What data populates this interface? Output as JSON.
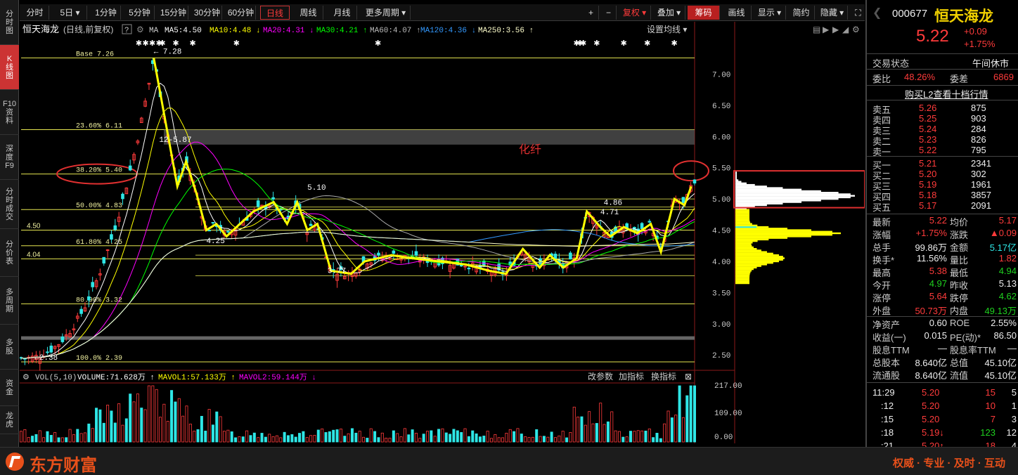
{
  "sidebar": [
    {
      "label": "分\n时\n图",
      "active": false
    },
    {
      "label": "K\n线\n图",
      "active": true
    },
    {
      "label": "F10\n资\n料",
      "active": false
    },
    {
      "label": "深\n度\nF9",
      "active": false
    },
    {
      "label": "分\n时\n成\n交",
      "active": false
    },
    {
      "label": "分\n价\n表",
      "active": false
    },
    {
      "label": "多\n周\n期",
      "active": false
    },
    {
      "label": "多\n股",
      "active": false
    },
    {
      "label": "资\n金",
      "active": false
    },
    {
      "label": "龙\n虎",
      "active": false
    }
  ],
  "toolbar": {
    "periods": [
      "分时",
      "5日 ▾",
      "1分钟",
      "5分钟",
      "15分钟",
      "30分钟",
      "60分钟",
      "日线",
      "周线",
      "月线",
      "更多周期 ▾"
    ],
    "active_period": "日线",
    "right_buttons": [
      "+",
      "−",
      "复权 ▾",
      "叠加 ▾",
      "筹码",
      "画线",
      "显示 ▾",
      "简约",
      "隐藏 ▾",
      "⛶"
    ],
    "active_right": "筹码"
  },
  "chart": {
    "header": {
      "name": "恒天海龙",
      "mode": "(日线,前复权)",
      "help": "?",
      "ma_items": [
        {
          "text": "MA",
          "color": "#cccccc"
        },
        {
          "text": "MA5:4.50",
          "color": "#ffffff"
        },
        {
          "text": "MA10:4.48 ↓",
          "color": "#ffff00"
        },
        {
          "text": "MA20:4.31 ↓",
          "color": "#ff00ff"
        },
        {
          "text": "MA30:4.21 ↑",
          "color": "#00ff00"
        },
        {
          "text": "MA60:4.07 ↑",
          "color": "#bbbbbb"
        },
        {
          "text": "MA120:4.36 ↓",
          "color": "#3399ff"
        },
        {
          "text": "MA250:3.56 ↑",
          "color": "#ffffcc"
        }
      ],
      "settings": "设置均线 ▾"
    },
    "price_axis": [
      "7.00",
      "6.50",
      "6.00",
      "5.50",
      "5.00",
      "4.50",
      "4.00",
      "3.50",
      "3.00",
      "2.50"
    ],
    "fib_labels": [
      "Base 7.26",
      "23.60% 6.11",
      "38.20% 5.40",
      "50.00% 4.83",
      "61.80% 4.25",
      "80.90% 3.32",
      "100.0% 2.39"
    ],
    "annotations": [
      "7.28",
      "12-5.87",
      "5.10",
      "4.25",
      "3.77",
      "4.86",
      "4.71",
      "4.50",
      "4.04",
      "2.38",
      "化纤"
    ],
    "volume": {
      "header": [
        "VOL(5,10)",
        "VOLUME:71.628万 ↑",
        "MAVOL1:57.133万 ↑",
        "MAVOL2:59.144万 ↓"
      ],
      "buttons": [
        "改参数",
        "加指标",
        "换指标"
      ],
      "axis": [
        "217.00",
        "109.00",
        "0.00"
      ]
    },
    "chart_data": {
      "type": "candlestick",
      "ylim": [
        2.3,
        7.5
      ],
      "fib_levels": [
        7.26,
        6.11,
        5.4,
        4.83,
        4.25,
        3.32,
        2.39
      ],
      "price_labels": [
        {
          "text": "7.28",
          "x": 0.197,
          "price": 7.28
        },
        {
          "text": "5.87",
          "x": 0.205,
          "price": 5.87
        },
        {
          "text": "5.10",
          "x": 0.425,
          "price": 5.1
        },
        {
          "text": "4.25",
          "x": 0.275,
          "price": 4.25
        },
        {
          "text": "3.77",
          "x": 0.455,
          "price": 3.77
        },
        {
          "text": "4.86",
          "x": 0.865,
          "price": 4.86
        },
        {
          "text": "4.71",
          "x": 0.86,
          "price": 4.71
        },
        {
          "text": "2.38",
          "x": 0.02,
          "price": 2.38
        }
      ],
      "zigzag": [
        [
          0.197,
          7.26
        ],
        [
          0.232,
          5.2
        ],
        [
          0.245,
          5.6
        ],
        [
          0.26,
          5.1
        ],
        [
          0.275,
          4.5
        ],
        [
          0.29,
          4.6
        ],
        [
          0.305,
          4.4
        ],
        [
          0.345,
          4.8
        ],
        [
          0.375,
          4.95
        ],
        [
          0.395,
          4.6
        ],
        [
          0.41,
          4.95
        ],
        [
          0.425,
          4.5
        ],
        [
          0.44,
          4.6
        ],
        [
          0.46,
          3.85
        ],
        [
          0.49,
          3.8
        ],
        [
          0.51,
          4.0
        ],
        [
          0.55,
          4.1
        ],
        [
          0.58,
          4.05
        ],
        [
          0.62,
          4.0
        ],
        [
          0.66,
          3.95
        ],
        [
          0.695,
          3.85
        ],
        [
          0.72,
          3.8
        ],
        [
          0.745,
          4.2
        ],
        [
          0.77,
          3.9
        ],
        [
          0.785,
          4.1
        ],
        [
          0.805,
          3.9
        ],
        [
          0.825,
          4.05
        ],
        [
          0.84,
          4.8
        ],
        [
          0.86,
          4.55
        ],
        [
          0.875,
          4.4
        ],
        [
          0.895,
          4.55
        ],
        [
          0.915,
          4.45
        ],
        [
          0.935,
          4.6
        ],
        [
          0.95,
          4.15
        ],
        [
          0.97,
          5.0
        ],
        [
          0.985,
          4.9
        ],
        [
          0.995,
          5.2
        ]
      ]
    }
  },
  "right_panel": {
    "code": "000677",
    "name": "恒天海龙",
    "price": "5.22",
    "change": "+0.09",
    "change_pct": "+1.75%",
    "trade_status_label": "交易状态",
    "trade_status": "午间休市",
    "weibi_label": "委比",
    "weibi": "48.26%",
    "weicha_label": "委差",
    "weicha": "6869",
    "l2_link": "购买L2查看十档行情",
    "sells": [
      {
        "label": "卖五",
        "price": "5.26",
        "vol": "875"
      },
      {
        "label": "卖四",
        "price": "5.25",
        "vol": "903"
      },
      {
        "label": "卖三",
        "price": "5.24",
        "vol": "284"
      },
      {
        "label": "卖二",
        "price": "5.23",
        "vol": "826"
      },
      {
        "label": "卖一",
        "price": "5.22",
        "vol": "795"
      }
    ],
    "buys": [
      {
        "label": "买一",
        "price": "5.21",
        "vol": "2341"
      },
      {
        "label": "买二",
        "price": "5.20",
        "vol": "302"
      },
      {
        "label": "买三",
        "price": "5.19",
        "vol": "1961"
      },
      {
        "label": "买四",
        "price": "5.18",
        "vol": "3857"
      },
      {
        "label": "买五",
        "price": "5.17",
        "vol": "2091"
      }
    ],
    "stats": [
      [
        "最新",
        "5.22",
        "up",
        "均价",
        "5.17",
        "up"
      ],
      [
        "涨幅",
        "+1.75%",
        "up",
        "涨跌",
        "▲0.09",
        "up"
      ],
      [
        "总手",
        "99.86万",
        "wh",
        "金额",
        "5.17亿",
        "cy"
      ],
      [
        "换手*",
        "11.56%",
        "wh",
        "量比",
        "1.82",
        "up"
      ],
      [
        "最高",
        "5.38",
        "up",
        "最低",
        "4.94",
        "dn"
      ],
      [
        "今开",
        "4.97",
        "dn",
        "昨收",
        "5.13",
        "wh"
      ],
      [
        "涨停",
        "5.64",
        "up",
        "跌停",
        "4.62",
        "dn"
      ],
      [
        "外盘",
        "50.73万",
        "up",
        "内盘",
        "49.13万",
        "dn"
      ],
      [
        "净资产",
        "0.60",
        "wh",
        "ROE",
        "2.55%",
        "wh"
      ],
      [
        "收益(一)",
        "0.015",
        "wh",
        "PE(动)*",
        "86.50",
        "wh"
      ],
      [
        "股息TTM",
        "—",
        "wh",
        "股息率TTM",
        "—",
        "wh"
      ],
      [
        "总股本",
        "8.640亿",
        "wh",
        "总值",
        "45.10亿",
        "wh"
      ],
      [
        "流通股",
        "8.640亿",
        "wh",
        "流值",
        "45.10亿",
        "wh"
      ]
    ],
    "ticks": [
      {
        "time": "11:29",
        "price": "5.20",
        "pc": "up",
        "vol": "15",
        "vc": "up",
        "n": "5"
      },
      {
        "time": ":12",
        "price": "5.20",
        "pc": "up",
        "vol": "10",
        "vc": "up",
        "n": "1"
      },
      {
        "time": ":15",
        "price": "5.20",
        "pc": "up",
        "vol": "7",
        "vc": "up",
        "n": "3"
      },
      {
        "time": ":18",
        "price": "5.19↓",
        "pc": "up",
        "vol": "123",
        "vc": "dn",
        "n": "12"
      },
      {
        "time": ":21",
        "price": "5.20↑",
        "pc": "up",
        "vol": "18",
        "vc": "up",
        "n": "4"
      }
    ]
  },
  "footer": {
    "brand": "东方财富",
    "slogan": "权威 · 专业 · 及时 · 互动"
  }
}
